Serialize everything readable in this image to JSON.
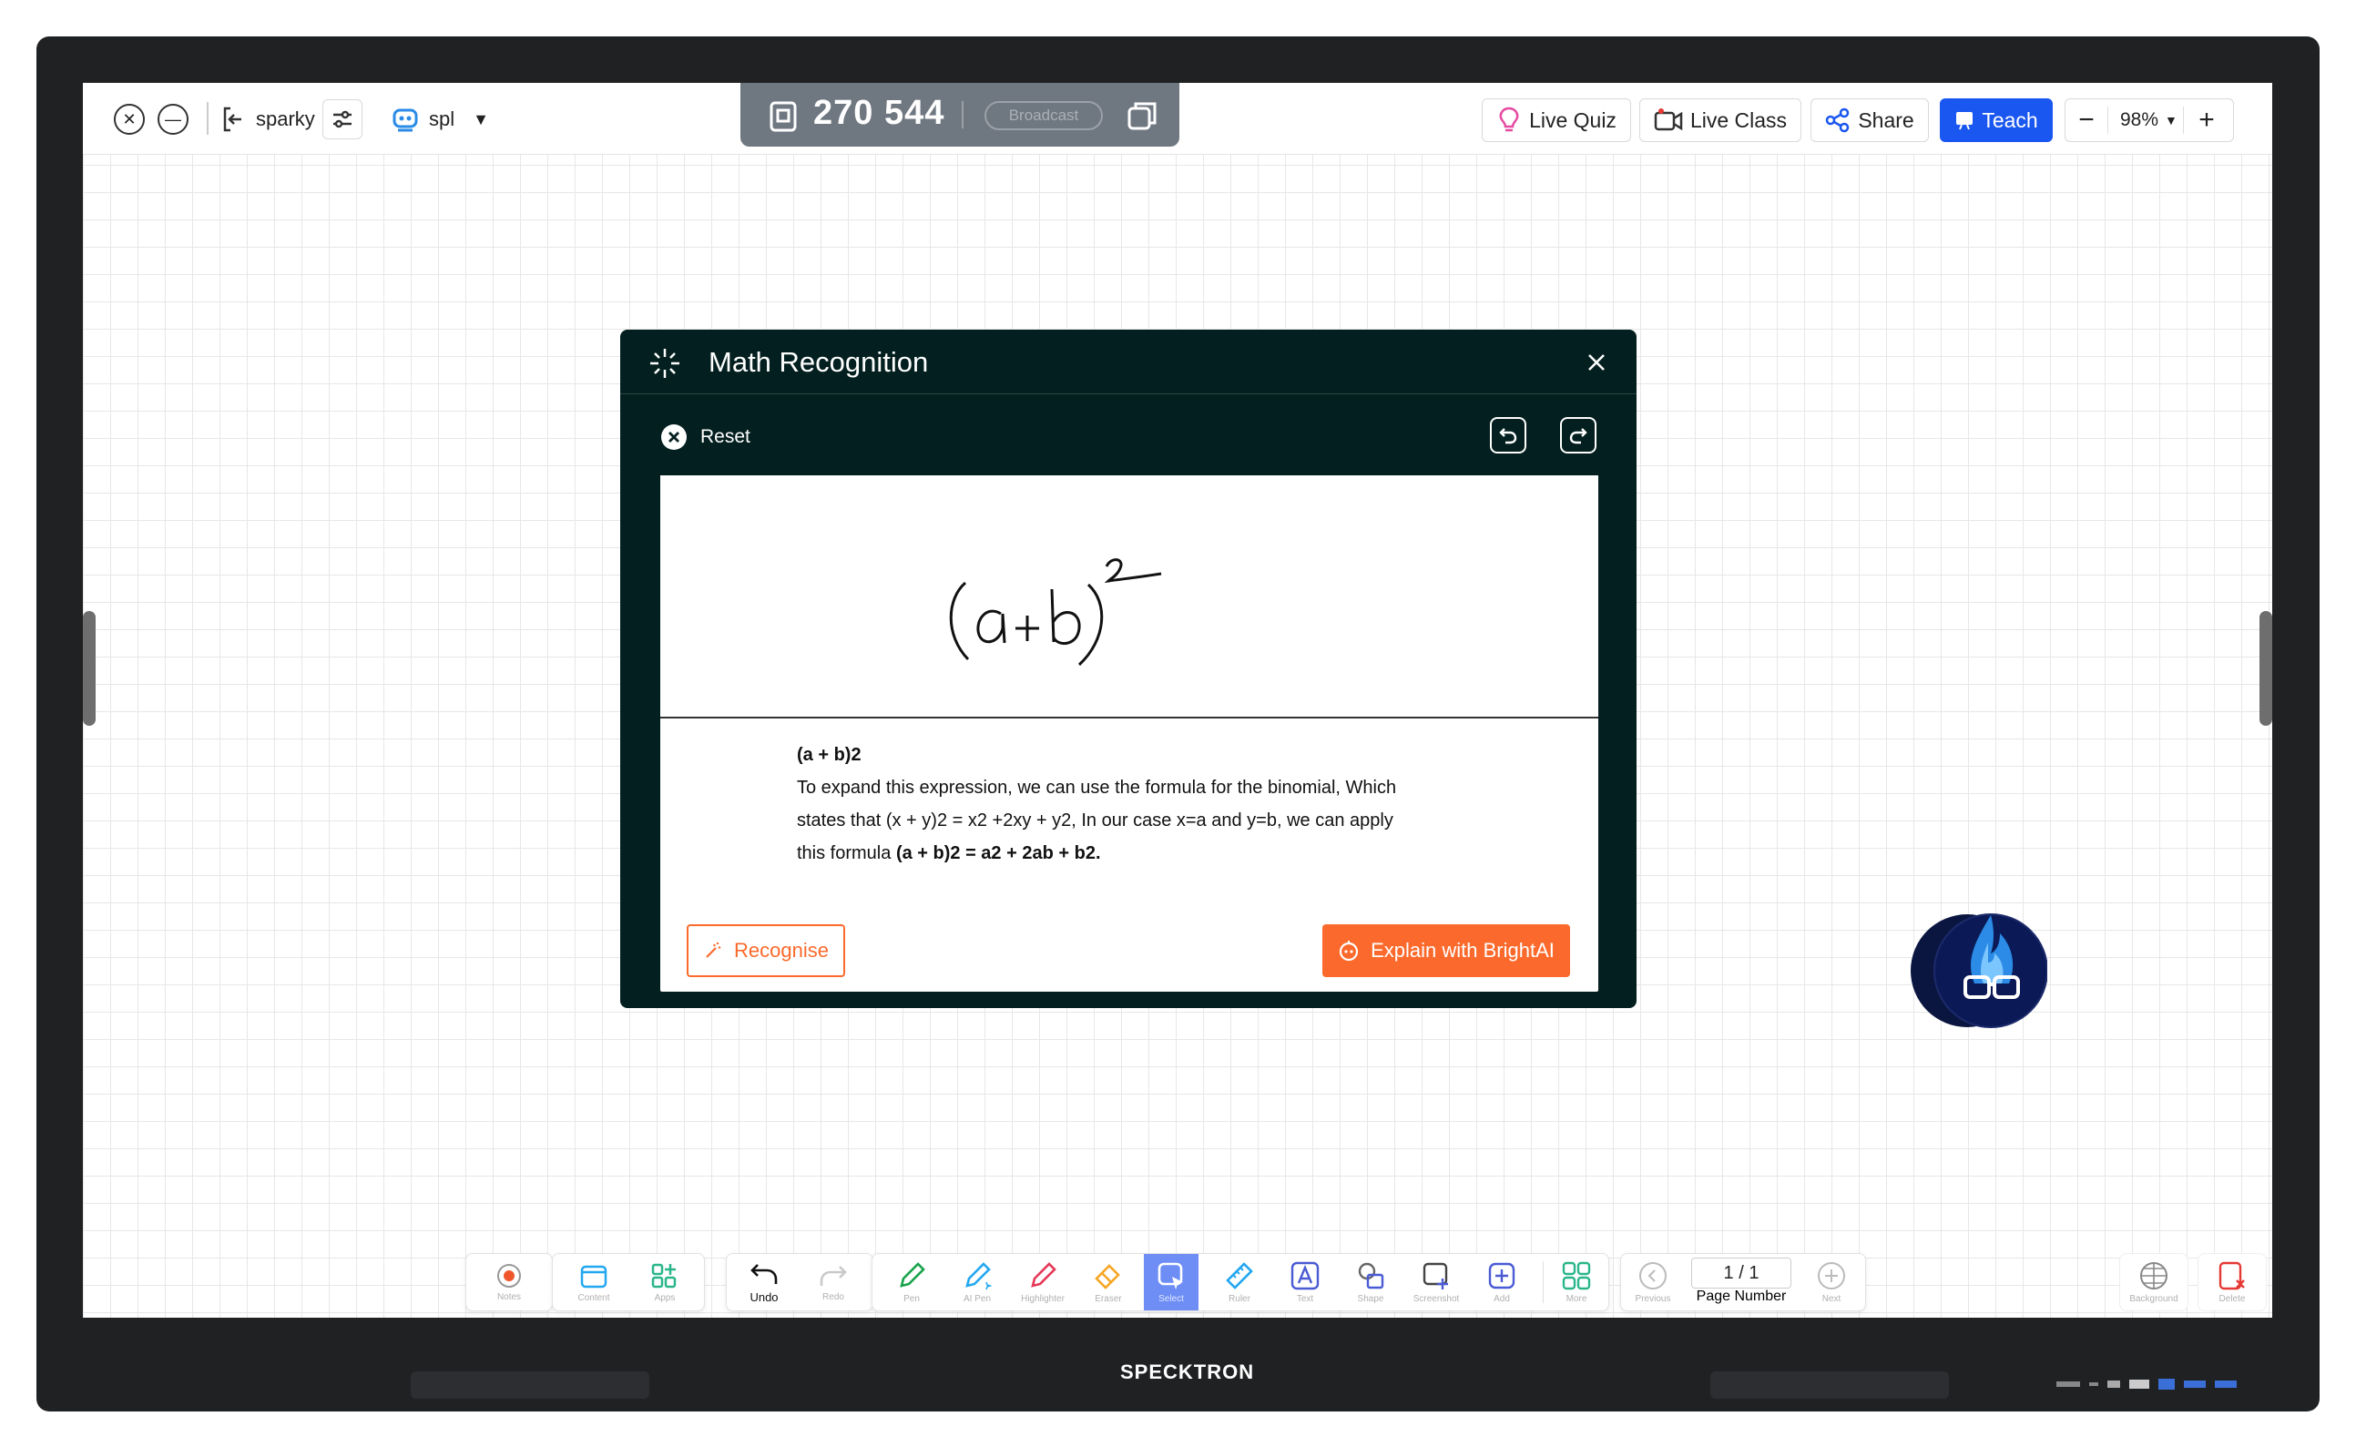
{
  "topbar": {
    "user_label": "sparky",
    "profile_label": "spl",
    "session_code": "270 544",
    "broadcast_label": "Broadcast",
    "live_quiz_label": "Live Quiz",
    "live_class_label": "Live Class",
    "share_label": "Share",
    "teach_label": "Teach",
    "zoom_value": "98%"
  },
  "modal": {
    "title": "Math Recognition",
    "reset_label": "Reset",
    "result_heading": "(a + b)2",
    "result_line1": "To expand this expression, we can use the formula for the binomial, Which",
    "result_line2": "states that (x + y)2 = x2 +2xy + y2, In our case x=a and y=b, we can apply",
    "result_line3_prefix": "this formula ",
    "result_formula": "(a + b)2 = a2 + 2ab + b2.",
    "recognise_label": "Recognise",
    "explain_label": "Explain with BrightAI"
  },
  "toolbar": {
    "notes": "Notes",
    "content": "Content",
    "apps": "Apps",
    "undo": "Undo",
    "redo": "Redo",
    "pen": "Pen",
    "ai_pen": "AI Pen",
    "highlighter": "Highlighter",
    "eraser": "Eraser",
    "select": "Select",
    "ruler": "Ruler",
    "text": "Text",
    "shape": "Shape",
    "screenshot": "Screenshot",
    "add": "Add",
    "more": "More",
    "previous": "Previous",
    "page_number_value": "1 / 1",
    "page_number_label": "Page Number",
    "next": "Next",
    "background": "Background",
    "delete": "Delete"
  },
  "device": {
    "brand": "SPECKTRON"
  },
  "colors": {
    "accent_orange": "#fb6a2c",
    "teach_blue": "#1a56f0",
    "modal_bg": "#041f1f"
  }
}
